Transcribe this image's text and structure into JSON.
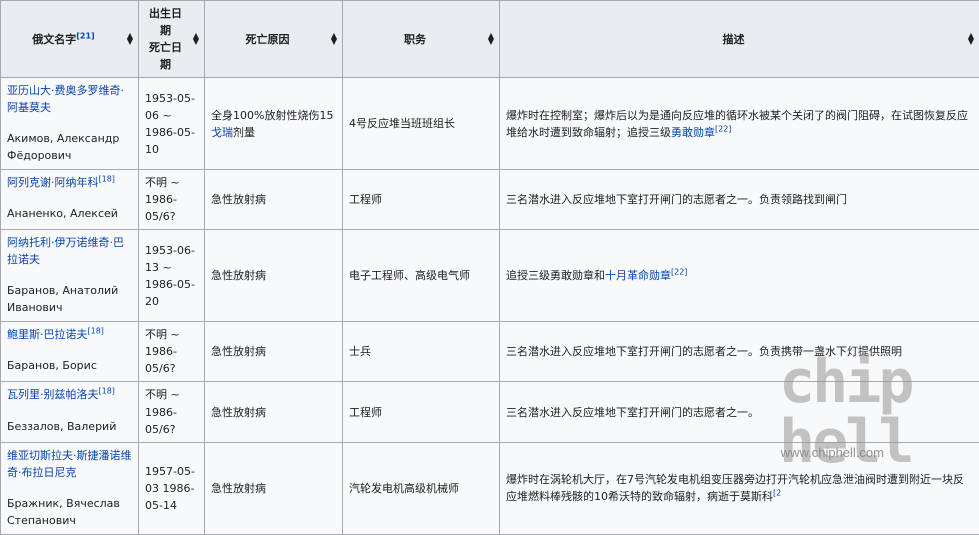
{
  "headers": [
    {
      "label": "俄文名字",
      "ref": "[21]"
    },
    {
      "label": "出生日期\n死亡日期",
      "ref": ""
    },
    {
      "label": "死亡原因",
      "ref": ""
    },
    {
      "label": "职务",
      "ref": ""
    },
    {
      "label": "描述",
      "ref": ""
    }
  ],
  "rows": [
    {
      "name_cn": "亚历山大·费奥多罗维奇·阿基莫夫",
      "name_ref": "",
      "name_ru": "Акимов, Александр Фёдорович",
      "dates": "1953-05-06 ~ 1986-05-10",
      "cause_text": "全身100%放射性烧伤15",
      "cause_link": "戈瑞",
      "cause_suffix": "剂量",
      "position": "4号反应堆当班班组长",
      "desc_text": "爆炸时在控制室；爆炸后以为是通向反应堆的循环水被某个关闭了的阀门阻碍，在试图恢复反应堆给水时遭到致命辐射；追授三级",
      "desc_link": "勇敢勋章",
      "desc_ref": "[22]"
    },
    {
      "name_cn": "阿列克谢·阿纳年科",
      "name_ref": "[18]",
      "name_ru": "Ананенко, Алексей",
      "dates": "不明 ~ 1986-05/6?",
      "cause_text": "急性放射病",
      "cause_link": "",
      "cause_suffix": "",
      "position": "工程师",
      "desc_text": "三名潜水进入反应堆地下室打开闸门的志愿者之一。负责领路找到闸门",
      "desc_link": "",
      "desc_ref": ""
    },
    {
      "name_cn": "阿纳托利·伊万诺维奇·巴拉诺夫",
      "name_ref": "",
      "name_ru": "Баранов, Анатолий Иванович",
      "dates": "1953-06-13 ~ 1986-05-20",
      "cause_text": "急性放射病",
      "cause_link": "",
      "cause_suffix": "",
      "position": "电子工程师、高级电气师",
      "desc_text": "追授三级勇敢勋章和",
      "desc_link": "十月革命勋章",
      "desc_ref": "[22]"
    },
    {
      "name_cn": "鲍里斯·巴拉诺夫",
      "name_ref": "[18]",
      "name_ru": "Баранов, Борис",
      "dates": "不明 ~ 1986-05/6?",
      "cause_text": "急性放射病",
      "cause_link": "",
      "cause_suffix": "",
      "position": "士兵",
      "desc_text": "三名潜水进入反应堆地下室打开闸门的志愿者之一。负责携带一盏水下灯提供照明",
      "desc_link": "",
      "desc_ref": ""
    },
    {
      "name_cn": "瓦列里·别兹帕洛夫",
      "name_ref": "[18]",
      "name_ru": "Беззалов, Валерий",
      "dates": "不明 ~ 1986-05/6?",
      "cause_text": "急性放射病",
      "cause_link": "",
      "cause_suffix": "",
      "position": "工程师",
      "desc_text": "三名潜水进入反应堆地下室打开闸门的志愿者之一。",
      "desc_link": "",
      "desc_ref": ""
    },
    {
      "name_cn": "维亚切斯拉夫·斯捷潘诺维奇·布拉日尼克",
      "name_ref": "",
      "name_ru": "Бражник, Вячеслав Степанович",
      "dates": "1957-05-03 1986-05-14",
      "cause_text": "急性放射病",
      "cause_link": "",
      "cause_suffix": "",
      "position": "汽轮发电机高级机械师",
      "desc_text": "爆炸时在涡轮机大厅，在7号汽轮发电机组变压器旁边打开汽轮机应急泄油阀时遭到附近一块反应堆燃料棒残骸的10希沃特的致命辐射，病逝于莫斯科",
      "desc_link": "",
      "desc_ref": "[2"
    }
  ],
  "watermark": {
    "logo": "chip hell",
    "url": "www.chiphell.com"
  }
}
